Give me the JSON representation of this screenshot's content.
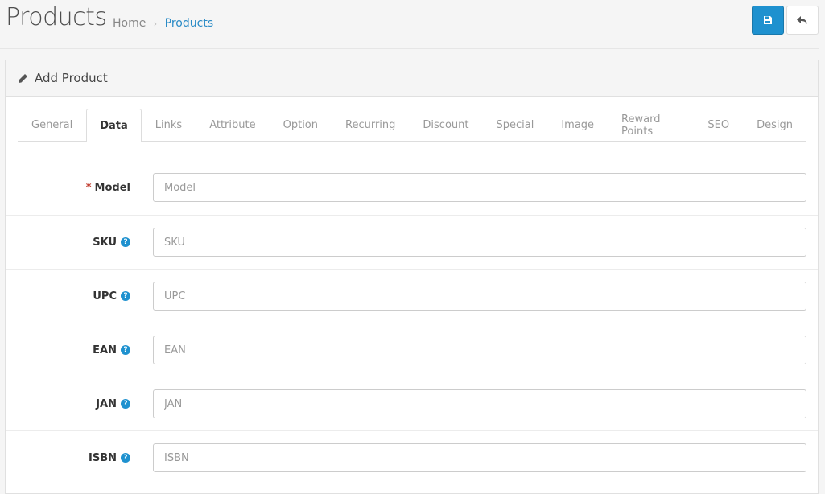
{
  "header": {
    "title": "Products",
    "breadcrumb": [
      {
        "label": "Home"
      },
      {
        "label": "Products"
      }
    ],
    "breadcrumb_separator": "›",
    "save_button": {
      "icon": "save-icon",
      "color": "#1e91cf"
    },
    "back_button": {
      "icon": "reply-icon"
    }
  },
  "panel": {
    "title": "Add Product",
    "icon": "pencil-icon"
  },
  "tabs": [
    {
      "label": "General",
      "active": false
    },
    {
      "label": "Data",
      "active": true
    },
    {
      "label": "Links",
      "active": false
    },
    {
      "label": "Attribute",
      "active": false
    },
    {
      "label": "Option",
      "active": false
    },
    {
      "label": "Recurring",
      "active": false
    },
    {
      "label": "Discount",
      "active": false
    },
    {
      "label": "Special",
      "active": false
    },
    {
      "label": "Image",
      "active": false
    },
    {
      "label": "Reward Points",
      "active": false
    },
    {
      "label": "SEO",
      "active": false
    },
    {
      "label": "Design",
      "active": false
    }
  ],
  "fields": [
    {
      "label": "Model",
      "required": true,
      "help": false,
      "value": "",
      "placeholder": "Model"
    },
    {
      "label": "SKU",
      "required": false,
      "help": true,
      "value": "",
      "placeholder": "SKU"
    },
    {
      "label": "UPC",
      "required": false,
      "help": true,
      "value": "",
      "placeholder": "UPC"
    },
    {
      "label": "EAN",
      "required": false,
      "help": true,
      "value": "",
      "placeholder": "EAN"
    },
    {
      "label": "JAN",
      "required": false,
      "help": true,
      "value": "",
      "placeholder": "JAN"
    },
    {
      "label": "ISBN",
      "required": false,
      "help": true,
      "value": "",
      "placeholder": "ISBN"
    }
  ],
  "required_marker": "*",
  "help_glyph": "?"
}
